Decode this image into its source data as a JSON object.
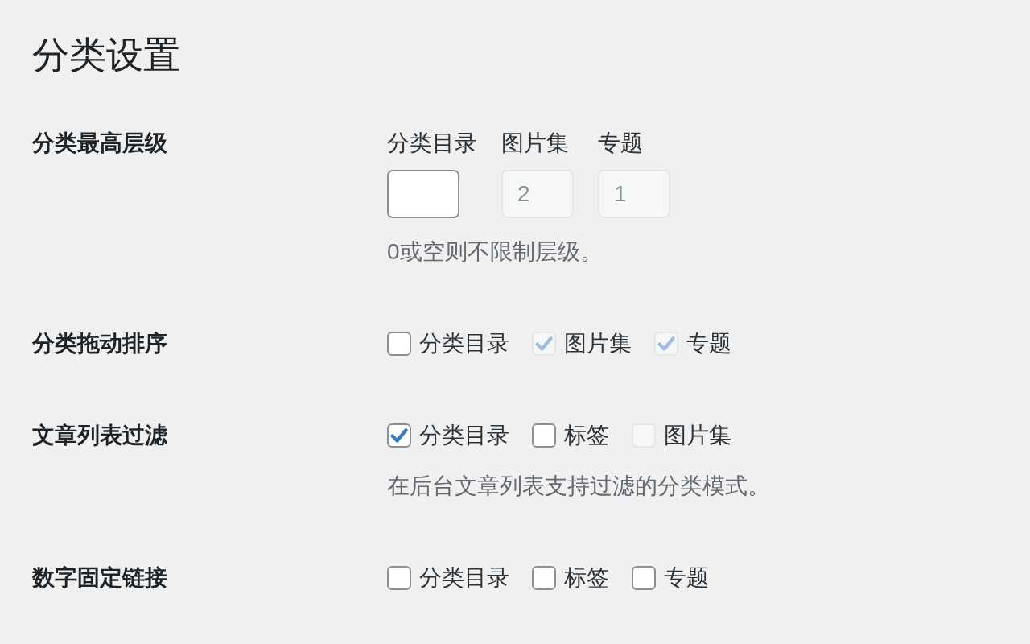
{
  "title": "分类设置",
  "settings": [
    {
      "kind": "number_fields",
      "label": "分类最高层级",
      "fields": [
        {
          "label": "分类目录",
          "disabled": false
        },
        {
          "label": "图片集",
          "value": "2",
          "disabled": true
        },
        {
          "label": "专题",
          "value": "1",
          "disabled": true
        }
      ],
      "description": "0或空则不限制层级。"
    },
    {
      "kind": "checkboxes",
      "label": "分类拖动排序",
      "options": [
        {
          "label": "分类目录",
          "checked": false,
          "disabled": false
        },
        {
          "label": "图片集",
          "checked": true,
          "disabled": true
        },
        {
          "label": "专题",
          "checked": true,
          "disabled": true
        }
      ]
    },
    {
      "kind": "checkboxes",
      "label": "文章列表过滤",
      "options": [
        {
          "label": "分类目录",
          "checked": true,
          "disabled": false
        },
        {
          "label": "标签",
          "checked": false,
          "disabled": false
        },
        {
          "label": "图片集",
          "checked": false,
          "disabled": true
        }
      ],
      "description": "在后台文章列表支持过滤的分类模式。"
    },
    {
      "kind": "checkboxes",
      "label": "数字固定链接",
      "options": [
        {
          "label": "分类目录",
          "checked": false,
          "disabled": false
        },
        {
          "label": "标签",
          "checked": false,
          "disabled": false
        },
        {
          "label": "专题",
          "checked": false,
          "disabled": false
        }
      ]
    }
  ]
}
